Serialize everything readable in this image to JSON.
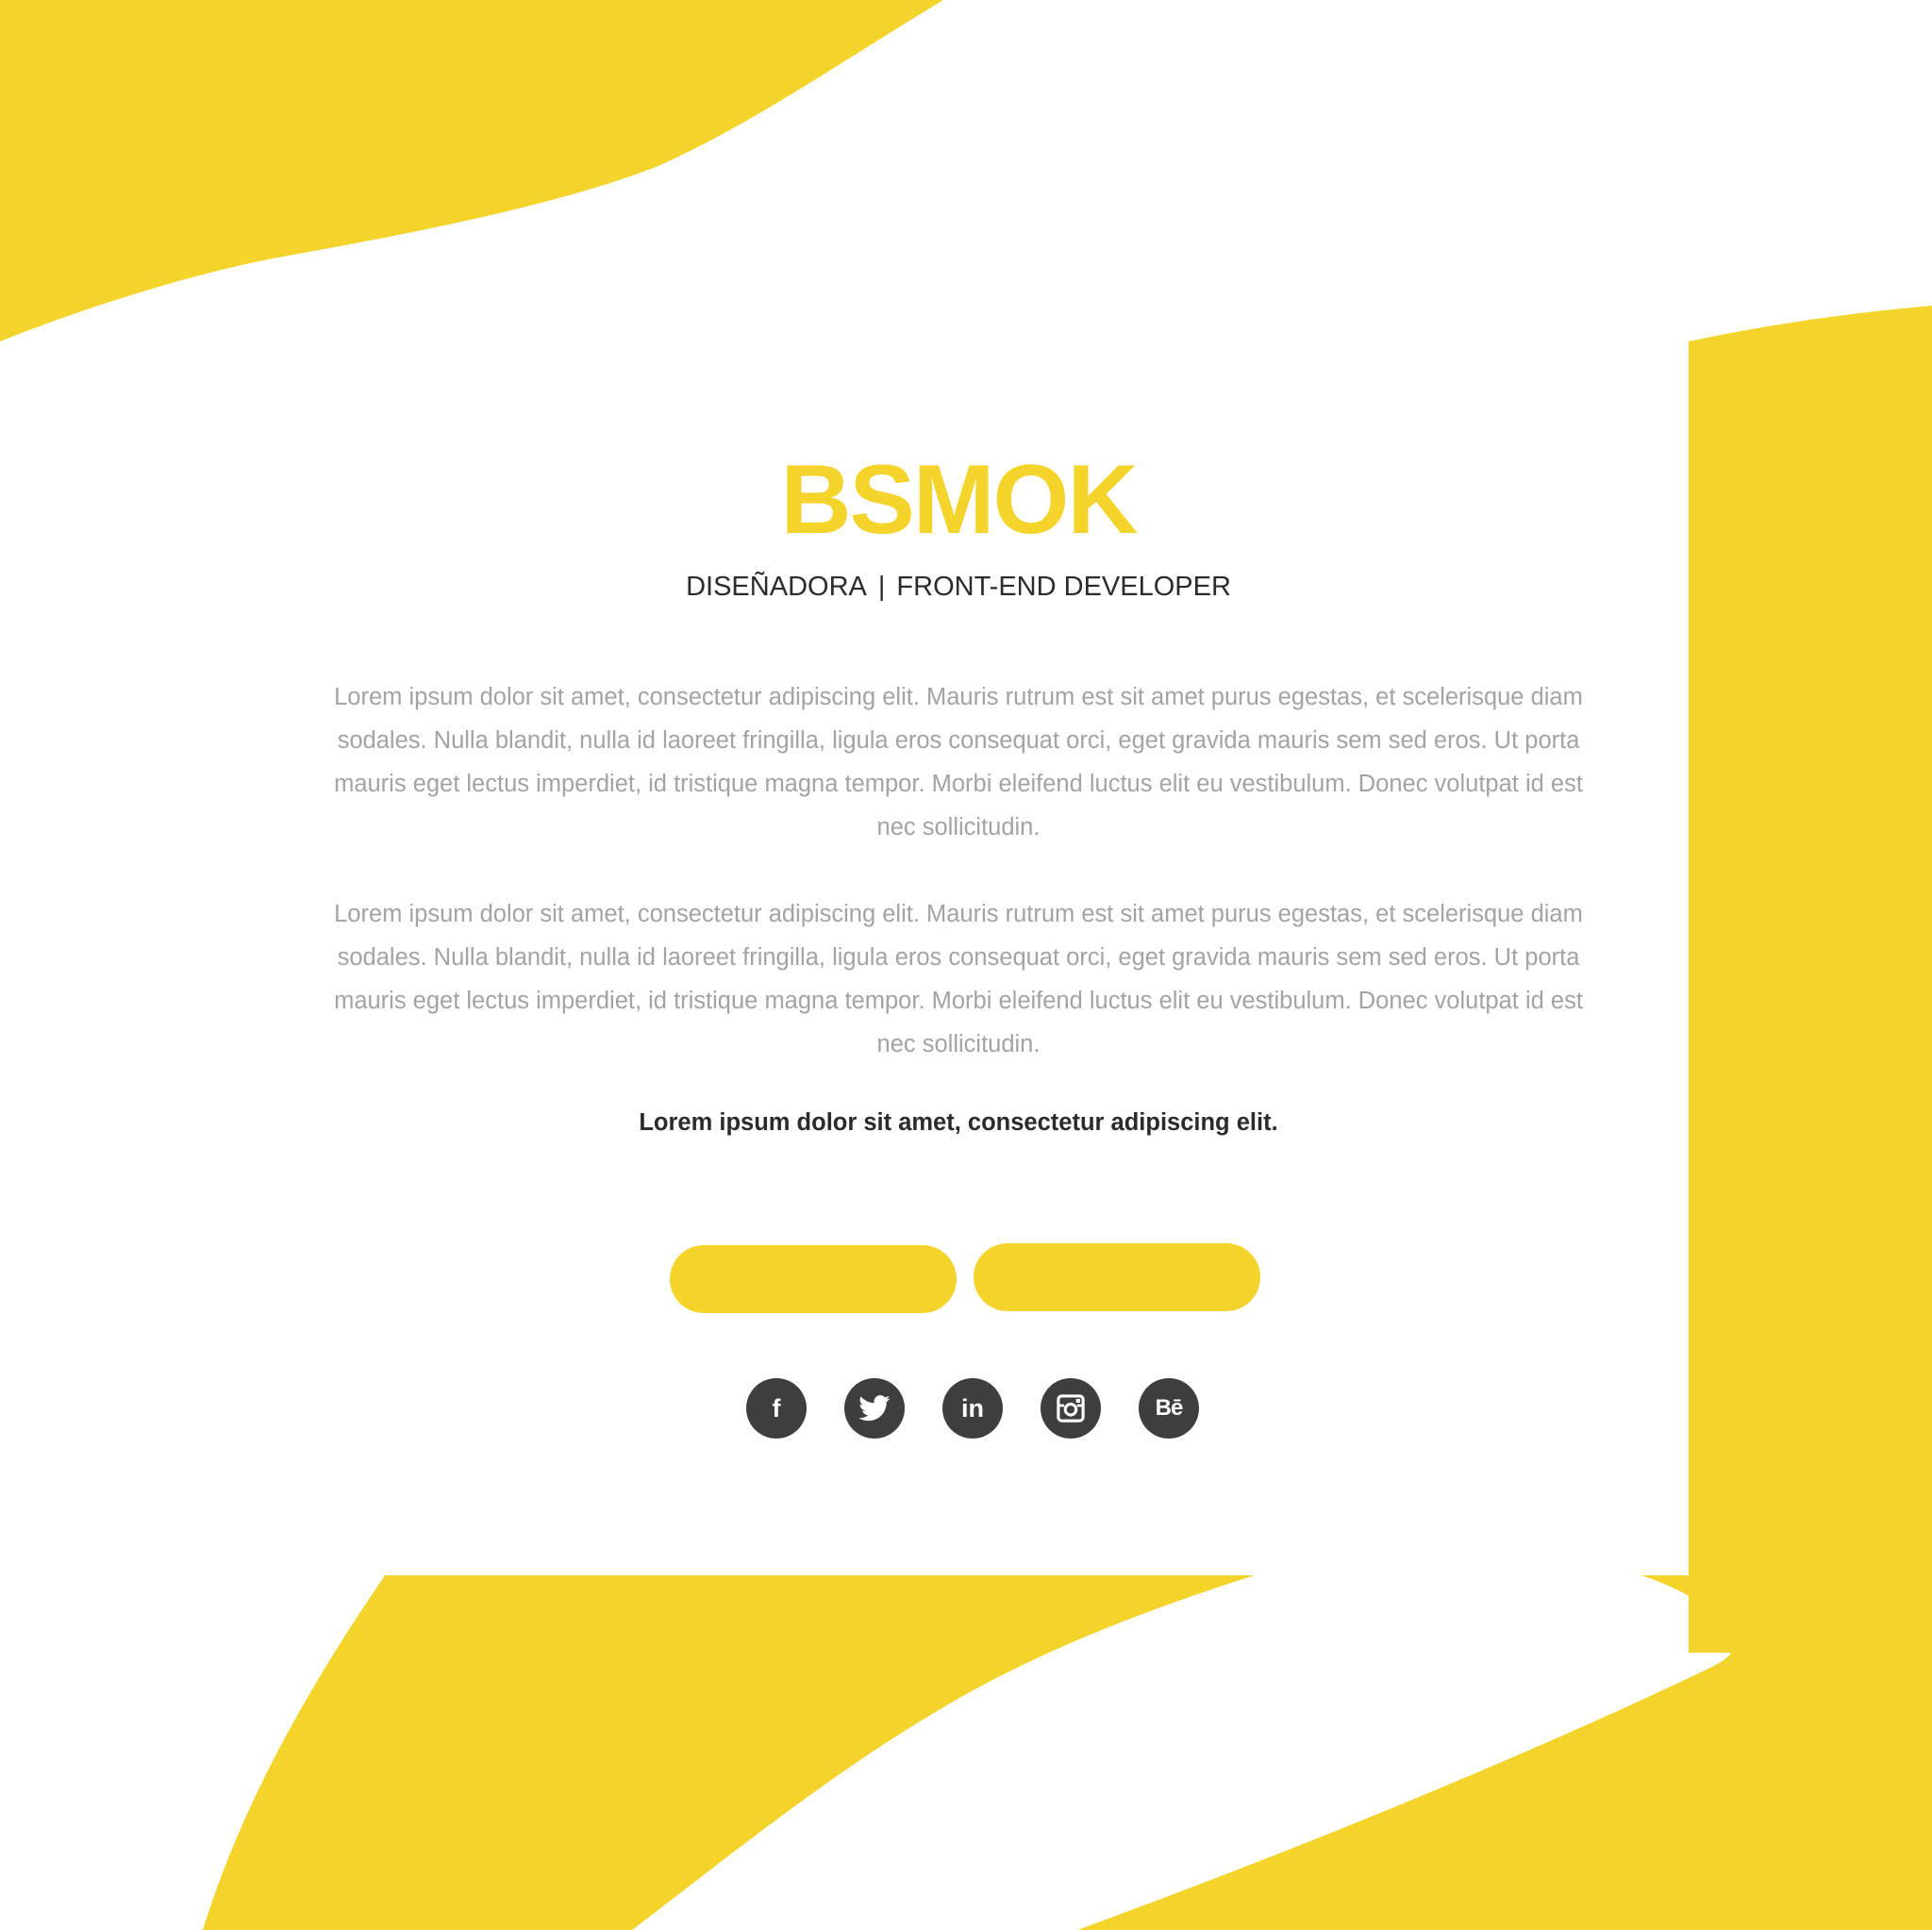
{
  "brand": {
    "title": "BSMOK",
    "role_primary": "DISEÑADORA",
    "role_separator": "|",
    "role_secondary": "FRONT-END DEVELOPER"
  },
  "about": {
    "paragraphs": [
      "Lorem ipsum dolor sit amet, consectetur adipiscing elit. Mauris rutrum est sit amet purus egestas, et scelerisque diam sodales. Nulla blandit, nulla id laoreet fringilla, ligula eros consequat orci, eget gravida mauris sem sed eros. Ut porta mauris eget lectus imperdiet, id tristique magna tempor. Morbi eleifend luctus elit eu vestibulum. Donec volutpat id est nec sollicitudin.",
      "Lorem ipsum dolor sit amet, consectetur adipiscing elit. Mauris rutrum est sit amet purus egestas, et scelerisque diam sodales. Nulla blandit, nulla id laoreet fringilla, ligula eros consequat orci, eget gravida mauris sem sed eros. Ut porta mauris eget lectus imperdiet, id tristique magna tempor. Morbi eleifend luctus elit eu vestibulum. Donec volutpat id est nec sollicitudin."
    ],
    "emphasis": "Lorem ipsum dolor sit amet, consectetur adipiscing elit."
  },
  "actions": {
    "primary_label": "",
    "secondary_label": ""
  },
  "social": [
    {
      "name": "facebook",
      "icon": "facebook-icon",
      "glyph": "f"
    },
    {
      "name": "twitter",
      "icon": "twitter-icon"
    },
    {
      "name": "linkedin",
      "icon": "linkedin-icon",
      "glyph": "in"
    },
    {
      "name": "instagram",
      "icon": "instagram-icon"
    },
    {
      "name": "behance",
      "icon": "behance-icon",
      "glyph": "Bē"
    }
  ],
  "colors": {
    "accent": "#f4d42a",
    "text_dark": "#2b2b2b",
    "text_muted": "#a3a3a3",
    "icon_bg": "#3e3e3e",
    "background": "#ffffff"
  }
}
